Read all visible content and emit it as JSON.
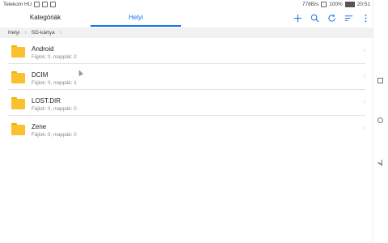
{
  "statusbar": {
    "carrier": "Telekom HU",
    "network_speed": "778B/s",
    "battery": "100%",
    "time": "20:51"
  },
  "tabs": [
    {
      "label": "Kategóriák"
    },
    {
      "label": "Helyi"
    }
  ],
  "actions": [
    {
      "icon": "add-icon"
    },
    {
      "icon": "search-icon"
    },
    {
      "icon": "refresh-icon"
    },
    {
      "icon": "sort-icon"
    },
    {
      "icon": "more-vert-icon"
    }
  ],
  "breadcrumb": [
    {
      "label": "Helyi"
    },
    {
      "label": "SD-kártya"
    }
  ],
  "folders": [
    {
      "name": "Android",
      "info": "Fájlok: 0, mappák: 2"
    },
    {
      "name": "DCIM",
      "info": "Fájlok: 0, mappák: 1"
    },
    {
      "name": "LOST.DIR",
      "info": "Fájlok: 0, mappák: 0"
    },
    {
      "name": "Zene",
      "info": "Fájlok: 0, mappák: 0"
    }
  ],
  "colors": {
    "accent": "#1a73e8",
    "folder": "#fbc02d"
  }
}
